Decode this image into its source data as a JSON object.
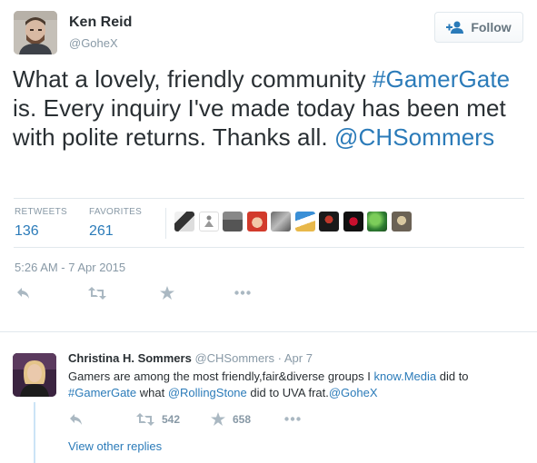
{
  "tweet": {
    "author_name": "Ken Reid",
    "author_handle": "@GoheX",
    "follow_label": "Follow",
    "text_parts": [
      "What a lovely, friendly community ",
      "#GamerGate",
      " is. Every inquiry I've made today has been met with polite returns. Thanks all. ",
      "@CHSommers"
    ],
    "retweets_label": "RETWEETS",
    "retweets_count": "136",
    "favorites_label": "FAVORITES",
    "favorites_count": "261",
    "timestamp": "5:26 AM - 7 Apr 2015"
  },
  "reply": {
    "author_name": "Christina H. Sommers",
    "author_handle": "@CHSommers",
    "separator": " · ",
    "date": "Apr 7",
    "text_parts": [
      "Gamers are among the most friendly,fair&diverse groups I ",
      "know.Media",
      " did to ",
      "#GamerGate",
      " what ",
      "@RollingStone",
      " did to UVA frat.",
      "@GoheX"
    ],
    "retweet_count": "542",
    "favorite_count": "658",
    "view_replies_label": "View other replies"
  },
  "colors": {
    "link": "#2b7bb9",
    "muted": "#8899a6",
    "text": "#292f33",
    "thread_line": "#cce4f6"
  },
  "icons": [
    "user-plus-icon",
    "reply-icon",
    "retweet-icon",
    "star-icon",
    "more-icon"
  ]
}
